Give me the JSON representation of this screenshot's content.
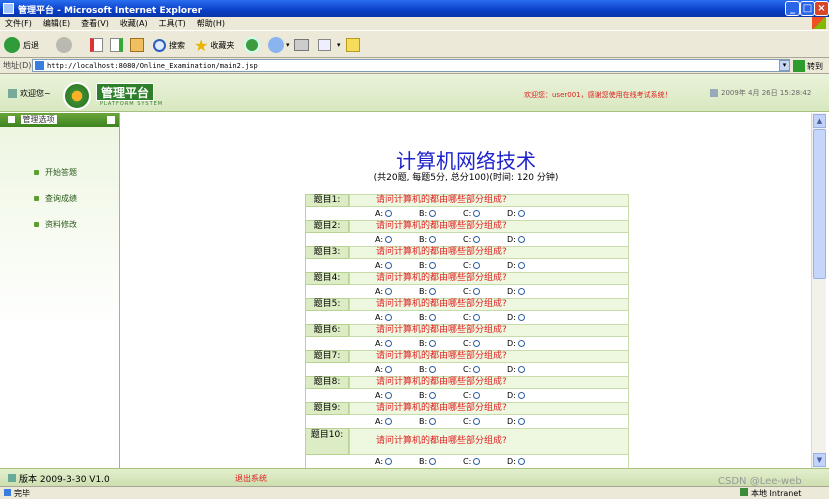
{
  "window": {
    "title": "管理平台 - Microsoft Internet Explorer"
  },
  "menu": [
    "文件(F)",
    "编辑(E)",
    "查看(V)",
    "收藏(A)",
    "工具(T)",
    "帮助(H)"
  ],
  "toolbar": {
    "back": "后退",
    "search": "搜索",
    "favorites": "收藏夹"
  },
  "address": {
    "label": "地址(D)",
    "url": "http://localhost:8080/Online_Examination/main2.jsp",
    "go": "转到"
  },
  "header": {
    "welcome": "欢迎您~",
    "logo_title": "管理平台",
    "logo_sub": "PLATFORM SYSTEM",
    "user_msg": "欢迎您：user001，感谢您使用在线考试系统！",
    "date": "2009年 4月 26日 15:28:42"
  },
  "sidebar": {
    "title": "管理选项",
    "items": [
      "开始答题",
      "查询成绩",
      "资料修改"
    ]
  },
  "exam": {
    "title": "计算机网络技术",
    "subtitle": "(共20题, 每题5分, 总分100)(时间: 120 分钟)",
    "option_labels": [
      "A:",
      "B:",
      "C:",
      "D:"
    ],
    "questions": [
      {
        "label": "题目1:",
        "text": "请问计算机的都由哪些部分组成?"
      },
      {
        "label": "题目2:",
        "text": "请问计算机的都由哪些部分组成?"
      },
      {
        "label": "题目3:",
        "text": "请问计算机的都由哪些部分组成?"
      },
      {
        "label": "题目4:",
        "text": "请问计算机的都由哪些部分组成?"
      },
      {
        "label": "题目5:",
        "text": "请问计算机的都由哪些部分组成?"
      },
      {
        "label": "题目6:",
        "text": "请问计算机的都由哪些部分组成?"
      },
      {
        "label": "题目7:",
        "text": "请问计算机的都由哪些部分组成?"
      },
      {
        "label": "题目8:",
        "text": "请问计算机的都由哪些部分组成?"
      },
      {
        "label": "题目9:",
        "text": "请问计算机的都由哪些部分组成?"
      },
      {
        "label": "题目10:",
        "text": "请问计算机的都由哪些部分组成?"
      }
    ]
  },
  "footer": {
    "version": "版本 2009-3-30 V1.0",
    "logout": "退出系统"
  },
  "status": {
    "left": "完毕",
    "right": "本地 Intranet"
  },
  "watermark": "CSDN @Lee-web"
}
